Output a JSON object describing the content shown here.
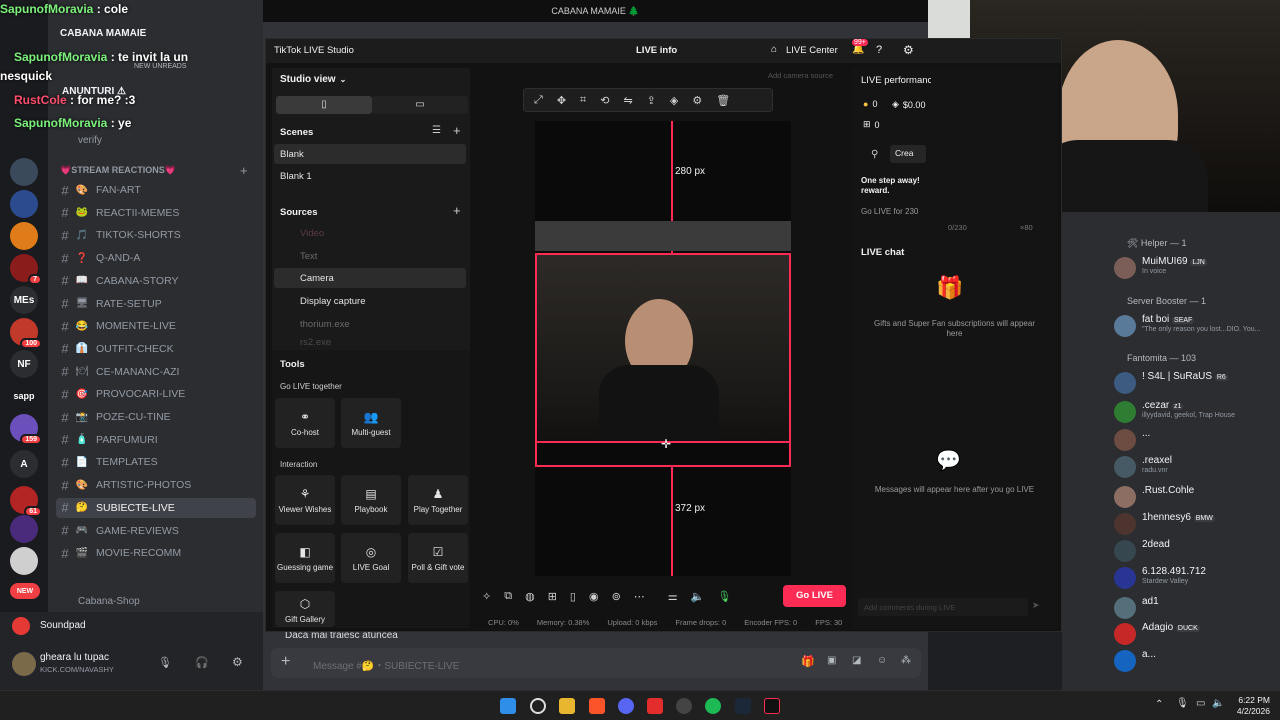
{
  "overlay": {
    "lines": [
      {
        "user": "SapunofMoravia",
        "text": ": cole"
      },
      {
        "user": "SapunofMoravia",
        "text": ": te invit la un"
      },
      {
        "user": "nesquick",
        "text": ""
      },
      {
        "user": "RustCole",
        "text": ": for me? :3"
      },
      {
        "user": "SapunofMoravia",
        "text": ": ye"
      }
    ],
    "new_unreads": "NEW UNREADS"
  },
  "top_bar": {
    "title": "CABANA MAMAIE 🌲"
  },
  "servers": [
    {
      "label": "",
      "badge": ""
    },
    {
      "label": "",
      "badge": ""
    },
    {
      "label": "",
      "badge": ""
    },
    {
      "label": "",
      "badge": "7"
    },
    {
      "label": "MEs",
      "badge": ""
    },
    {
      "label": "",
      "badge": "100"
    },
    {
      "label": "NF",
      "badge": ""
    },
    {
      "label": "sapp",
      "badge": ""
    },
    {
      "label": "",
      "badge": "159"
    },
    {
      "label": "A",
      "badge": ""
    },
    {
      "label": "",
      "badge": "61"
    },
    {
      "label": "",
      "badge": ""
    },
    {
      "label": "",
      "badge": ""
    },
    {
      "label": "NEW",
      "badge": ""
    }
  ],
  "channels": {
    "server_name": "CABANA MAMAIE",
    "anunturi": "ANUNTURI ⚠",
    "verify": "verify",
    "category_reactions": "💗STREAM REACTIONS💗",
    "items": [
      {
        "emoji": "🎨",
        "name": "FAN-ART"
      },
      {
        "emoji": "🐸",
        "name": "REACTII-MEMES"
      },
      {
        "emoji": "🎵",
        "name": "TIKTOK-SHORTS"
      },
      {
        "emoji": "❓",
        "name": "Q-AND-A"
      },
      {
        "emoji": "📖",
        "name": "CABANA-STORY"
      },
      {
        "emoji": "🖥",
        "name": "RATE-SETUP"
      },
      {
        "emoji": "😂",
        "name": "MOMENTE-LIVE"
      },
      {
        "emoji": "👔",
        "name": "OUTFIT-CHECK"
      },
      {
        "emoji": "🍽",
        "name": "CE-MANANC-AZI"
      },
      {
        "emoji": "🎯",
        "name": "PROVOCARI-LIVE"
      },
      {
        "emoji": "📸",
        "name": "POZE-CU-TINE"
      },
      {
        "emoji": "🧴",
        "name": "PARFUMURI"
      },
      {
        "emoji": "📄",
        "name": "TEMPLATES"
      },
      {
        "emoji": "🎨",
        "name": "ARTISTIC-PHOTOS"
      },
      {
        "emoji": "🤔",
        "name": "SUBIECTE-LIVE"
      },
      {
        "emoji": "🎮",
        "name": "GAME-REVIEWS"
      },
      {
        "emoji": "🎬",
        "name": "MOVIE-RECOMM"
      }
    ],
    "shop": "Cabana-Shop",
    "soundpad": "Soundpad",
    "user_name": "gheara lu tupac",
    "user_status": "KICK.COM/NAVASHY"
  },
  "chat": {
    "last_message": "Daca mai traiesc atuncea",
    "input_placeholder": "Message #🤔・SUBIECTE-LIVE"
  },
  "tiktok": {
    "app_title": "TikTok LIVE Studio",
    "live_info": "LIVE info",
    "live_center": "LIVE Center",
    "notif_badge": "99+",
    "studio_view": "Studio view",
    "scenes_label": "Scenes",
    "scenes": [
      "Blank",
      "Blank 1"
    ],
    "sources_label": "Sources",
    "sources": [
      "Video",
      "Text",
      "Camera",
      "Display capture",
      "thorium.exe",
      "rs2.exe"
    ],
    "tools_label": "Tools",
    "go_live_together": "Go LIVE together",
    "together_tiles": [
      "Co-host",
      "Multi-guest"
    ],
    "interaction_label": "Interaction",
    "interaction_tiles": [
      "Viewer Wishes",
      "Playbook",
      "Play Together",
      "Guessing game",
      "LIVE Goal",
      "Poll & Gift vote"
    ],
    "gift_gallery": "Gift Gallery",
    "add_camera_source": "Add camera source",
    "measure_top": "280 px",
    "measure_bottom": "372 px",
    "go_live_button": "Go LIVE",
    "stats": {
      "cpu": "CPU: 0%",
      "memory": "Memory: 0.38%",
      "upload": "Upload: 0 kbps",
      "frame_drops": "Frame drops: 0",
      "encoder_fps": "Encoder FPS: 0",
      "fps": "FPS: 30"
    },
    "performance_title": "LIVE performance",
    "perf_coins": "0",
    "perf_money": "$0.00",
    "perf_gifts": "0",
    "create_label": "Crea",
    "one_step": "One step away! reward.",
    "go_live_for": "Go LIVE for 230",
    "progress_text": "0/230",
    "progress_extra": "×80",
    "live_chat_label": "LIVE chat",
    "gifts_hint": "Gifts and Super Fan subscriptions will appear here",
    "messages_hint": "Messages will appear here after you go LIVE",
    "comment_placeholder": "Add comments during LIVE"
  },
  "members": {
    "group_helper": "🛠 Helper — 1",
    "group_booster": "Server Booster — 1",
    "group_fantomita": "Fantomita — 103",
    "list": [
      {
        "name": "MuiMUI69",
        "tag": "LJN",
        "sub": "In voice",
        "group": "helper"
      },
      {
        "name": "fat boi",
        "tag": "SEAF",
        "sub": "\"The only reason you lost...DIO. You...",
        "group": "booster"
      },
      {
        "name": "! S4L | SuRaUS",
        "tag": "R6",
        "sub": "",
        "group": "fantomita"
      },
      {
        "name": ".cezar",
        "tag": "z1",
        "sub": "illyydavid, geekol, Trap House",
        "group": "fantomita"
      },
      {
        "name": "...",
        "tag": "",
        "sub": "",
        "group": "fantomita"
      },
      {
        "name": ".reaxel",
        "tag": "",
        "sub": "radu.vnr",
        "group": "fantomita"
      },
      {
        "name": ".Rust.Cohle",
        "tag": "",
        "sub": "",
        "group": "fantomita"
      },
      {
        "name": "1hennesy6",
        "tag": "BMW",
        "sub": "",
        "group": "fantomita"
      },
      {
        "name": "2dead",
        "tag": "",
        "sub": "",
        "group": "fantomita"
      },
      {
        "name": "6.128.491.712",
        "tag": "",
        "sub": "Stardew Valley",
        "group": "fantomita"
      },
      {
        "name": "ad1",
        "tag": "",
        "sub": "",
        "group": "fantomita"
      },
      {
        "name": "Adagio",
        "tag": "DUCK",
        "sub": "",
        "group": "fantomita"
      },
      {
        "name": "a...",
        "tag": "",
        "sub": "",
        "group": "fantomita"
      }
    ]
  },
  "taskbar": {
    "time": "6:22 PM",
    "date": "4/2/2026"
  },
  "colors": {
    "accent": "#fe2c55",
    "discord_bg": "#313338",
    "sidebar": "#2b2d31",
    "online": "#23a55a"
  }
}
